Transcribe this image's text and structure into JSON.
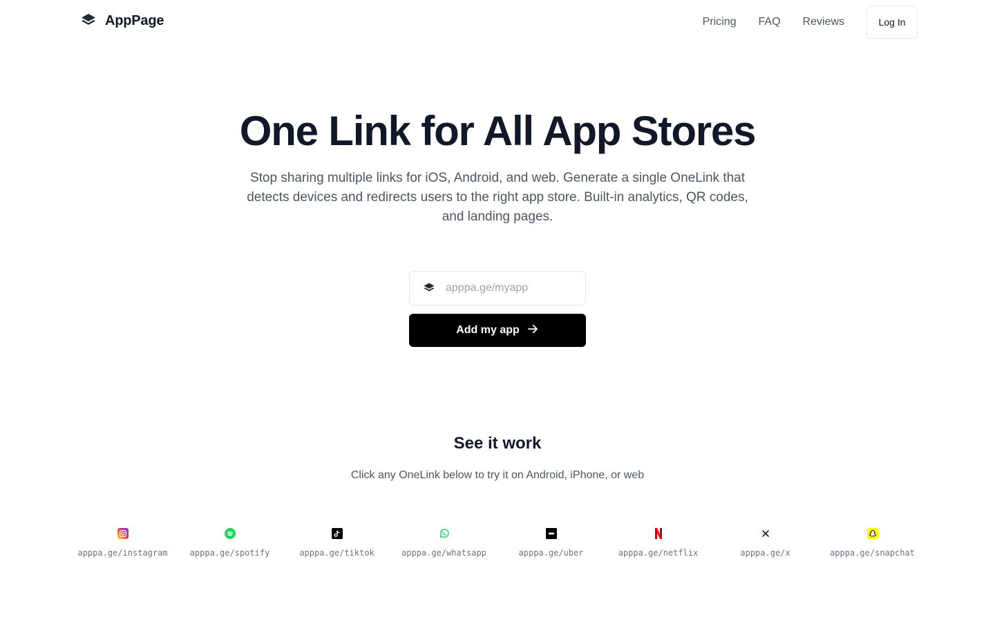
{
  "brand": {
    "name": "AppPage",
    "icon": "layers-icon"
  },
  "nav": {
    "links": [
      "Pricing",
      "FAQ",
      "Reviews"
    ],
    "login_label": "Log In"
  },
  "hero": {
    "title": "One Link for All App Stores",
    "subtitle": "Stop sharing multiple links for iOS, Android, and web. Generate a single OneLink that detects devices and redirects users to the right app store. Built-in analytics, QR codes, and landing pages.",
    "input_placeholder": "apppa.ge/myapp",
    "input_value": "",
    "cta_label": "Add my app"
  },
  "demo": {
    "title": "See it work",
    "subtitle": "Click any OneLink below to try it on Android, iPhone, or web",
    "apps": [
      {
        "url": "apppa.ge/instagram",
        "icon": "instagram-icon",
        "color": "#E1306C"
      },
      {
        "url": "apppa.ge/spotify",
        "icon": "spotify-icon",
        "color": "#1ED760"
      },
      {
        "url": "apppa.ge/tiktok",
        "icon": "tiktok-icon",
        "color": "#000000"
      },
      {
        "url": "apppa.ge/whatsapp",
        "icon": "whatsapp-icon",
        "color": "#25D366"
      },
      {
        "url": "apppa.ge/uber",
        "icon": "uber-icon",
        "color": "#000000"
      },
      {
        "url": "apppa.ge/netflix",
        "icon": "netflix-icon",
        "color": "#E50914"
      },
      {
        "url": "apppa.ge/x",
        "icon": "x-icon",
        "color": "#000000"
      },
      {
        "url": "apppa.ge/snapchat",
        "icon": "snapchat-icon",
        "color": "#FFFC00"
      }
    ]
  },
  "colors": {
    "text": "#111827",
    "muted": "#4b5563",
    "cta_bg": "#000000",
    "border": "#e5e7eb"
  }
}
